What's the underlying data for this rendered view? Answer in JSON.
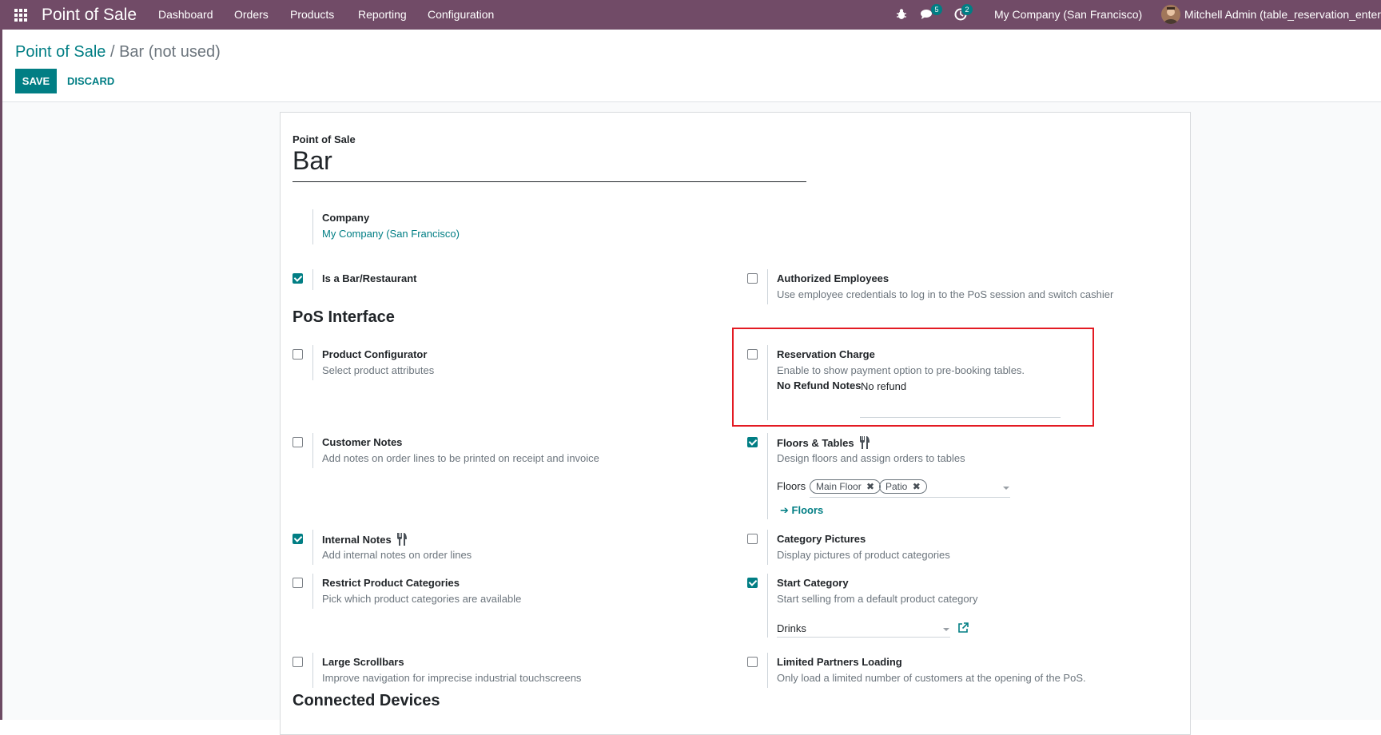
{
  "navbar": {
    "app_name": "Point of Sale",
    "menu": [
      "Dashboard",
      "Orders",
      "Products",
      "Reporting",
      "Configuration"
    ],
    "messages_badge": "5",
    "activities_badge": "2",
    "company": "My Company (San Francisco)",
    "user": "Mitchell Admin (table_reservation_enterpri"
  },
  "breadcrumb": {
    "parent": "Point of Sale",
    "separator": " / ",
    "current": "Bar (not used)"
  },
  "actions": {
    "save": "SAVE",
    "discard": "DISCARD"
  },
  "form": {
    "name_label": "Point of Sale",
    "name_value": "Bar",
    "company_label": "Company",
    "company_value": "My Company (San Francisco)",
    "is_bar": {
      "label": "Is a Bar/Restaurant",
      "checked": true
    },
    "authorized_employees": {
      "label": "Authorized Employees",
      "desc": "Use employee credentials to log in to the PoS session and switch cashier",
      "checked": false
    },
    "pos_interface_heading": "PoS Interface",
    "product_configurator": {
      "label": "Product Configurator",
      "desc": "Select product attributes",
      "checked": false
    },
    "reservation_charge": {
      "label": "Reservation Charge",
      "desc": "Enable to show payment option to pre-booking tables.",
      "no_refund_label": "No Refund Notes",
      "no_refund_value": "No refund",
      "checked": false
    },
    "customer_notes": {
      "label": "Customer Notes",
      "desc": "Add notes on order lines to be printed on receipt and invoice",
      "checked": false
    },
    "floors_tables": {
      "label": "Floors & Tables",
      "desc": "Design floors and assign orders to tables",
      "floors_label": "Floors",
      "floor_tags": [
        "Main Floor",
        "Patio"
      ],
      "floors_link": "Floors",
      "checked": true
    },
    "internal_notes": {
      "label": "Internal Notes",
      "desc": "Add internal notes on order lines",
      "checked": true
    },
    "category_pictures": {
      "label": "Category Pictures",
      "desc": "Display pictures of product categories",
      "checked": false
    },
    "restrict_categories": {
      "label": "Restrict Product Categories",
      "desc": "Pick which product categories are available",
      "checked": false
    },
    "start_category": {
      "label": "Start Category",
      "desc": "Start selling from a default product category",
      "value": "Drinks",
      "checked": true
    },
    "large_scrollbars": {
      "label": "Large Scrollbars",
      "desc": "Improve navigation for imprecise industrial touchscreens",
      "checked": false
    },
    "limited_partners": {
      "label": "Limited Partners Loading",
      "desc": "Only load a limited number of customers at the opening of the PoS.",
      "checked": false
    },
    "connected_devices_heading": "Connected Devices"
  },
  "colors": {
    "navbar": "#714b67",
    "primary": "#017e84",
    "highlight": "#e31b23"
  }
}
